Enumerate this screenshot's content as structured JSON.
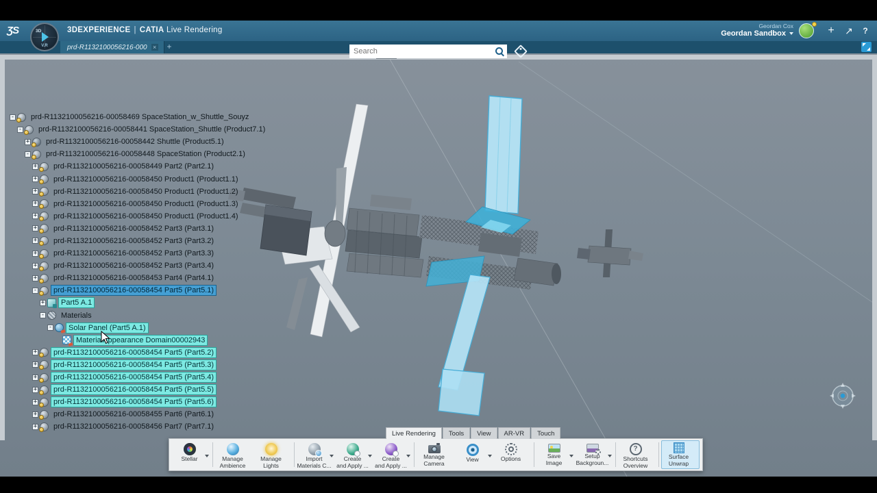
{
  "colors": {
    "accent_blue": "#2a9bd5",
    "selection_blue": "#459fd3",
    "highlight_cyan": "#7de9e2",
    "header_blue": "#2c6384",
    "viewport_gray": "#7c8994"
  },
  "header": {
    "logo": "ƷS",
    "brand": "3DEXPERIENCE",
    "divider": "|",
    "app": "CATIA",
    "mode": "Live Rendering",
    "search": {
      "placeholder": "Search"
    },
    "user": {
      "name": "Geordan Cox",
      "workspace": "Geordan Sandbox"
    },
    "icons": {
      "plus": "+",
      "share": "↗",
      "help": "?"
    }
  },
  "compass": {
    "top": "3D",
    "bottom": "V.R"
  },
  "tabbar": {
    "active_tab": "prd-R1132100056216-000",
    "close": "×",
    "new_tab": "+"
  },
  "tree": {
    "items": [
      {
        "indent": 0,
        "exp": "-",
        "icon": "assembly",
        "label": "prd-R1132100056216-00058469 SpaceStation_w_Shuttle_Souyz",
        "state": "normal"
      },
      {
        "indent": 1,
        "exp": "-",
        "icon": "assembly",
        "label": "prd-R1132100056216-00058441 SpaceStation_Shuttle (Product7.1)",
        "state": "normal"
      },
      {
        "indent": 2,
        "exp": "+",
        "icon": "shuttle",
        "label": "prd-R1132100056216-00058442 Shuttle (Product5.1)",
        "state": "normal"
      },
      {
        "indent": 2,
        "exp": "-",
        "icon": "assembly",
        "label": "prd-R1132100056216-00058448 SpaceStation (Product2.1)",
        "state": "normal"
      },
      {
        "indent": 3,
        "exp": "+",
        "icon": "part",
        "label": "prd-R1132100056216-00058449 Part2 (Part2.1)",
        "state": "normal"
      },
      {
        "indent": 3,
        "exp": "+",
        "icon": "part",
        "label": "prd-R1132100056216-00058450 Product1 (Product1.1)",
        "state": "normal"
      },
      {
        "indent": 3,
        "exp": "+",
        "icon": "part",
        "label": "prd-R1132100056216-00058450 Product1 (Product1.2)",
        "state": "normal"
      },
      {
        "indent": 3,
        "exp": "+",
        "icon": "part",
        "label": "prd-R1132100056216-00058450 Product1 (Product1.3)",
        "state": "normal"
      },
      {
        "indent": 3,
        "exp": "+",
        "icon": "part",
        "label": "prd-R1132100056216-00058450 Product1 (Product1.4)",
        "state": "normal"
      },
      {
        "indent": 3,
        "exp": "+",
        "icon": "part",
        "label": "prd-R1132100056216-00058452 Part3 (Part3.1)",
        "state": "normal"
      },
      {
        "indent": 3,
        "exp": "+",
        "icon": "part",
        "label": "prd-R1132100056216-00058452 Part3 (Part3.2)",
        "state": "normal"
      },
      {
        "indent": 3,
        "exp": "+",
        "icon": "part",
        "label": "prd-R1132100056216-00058452 Part3 (Part3.3)",
        "state": "normal"
      },
      {
        "indent": 3,
        "exp": "+",
        "icon": "part",
        "label": "prd-R1132100056216-00058452 Part3 (Part3.4)",
        "state": "normal"
      },
      {
        "indent": 3,
        "exp": "+",
        "icon": "part",
        "label": "prd-R1132100056216-00058453 Part4 (Part4.1)",
        "state": "normal"
      },
      {
        "indent": 3,
        "exp": "-",
        "icon": "part",
        "label": "prd-R1132100056216-00058454 Part5 (Part5.1)",
        "state": "selected"
      },
      {
        "indent": 4,
        "exp": "+",
        "icon": "rep",
        "label": "Part5 A.1",
        "state": "highlight"
      },
      {
        "indent": 4,
        "exp": "-",
        "icon": "materials",
        "label": "Materials",
        "state": "normal"
      },
      {
        "indent": 5,
        "exp": "-",
        "icon": "material",
        "label": "Solar Panel (Part5 A.1)",
        "state": "highlight"
      },
      {
        "indent": 6,
        "exp": null,
        "icon": "domain",
        "label": "MaterialAppearance Domain00002943",
        "state": "highlight"
      },
      {
        "indent": 3,
        "exp": "+",
        "icon": "part",
        "label": "prd-R1132100056216-00058454 Part5 (Part5.2)",
        "state": "highlight"
      },
      {
        "indent": 3,
        "exp": "+",
        "icon": "part",
        "label": "prd-R1132100056216-00058454 Part5 (Part5.3)",
        "state": "highlight"
      },
      {
        "indent": 3,
        "exp": "+",
        "icon": "part",
        "label": "prd-R1132100056216-00058454 Part5 (Part5.4)",
        "state": "highlight"
      },
      {
        "indent": 3,
        "exp": "+",
        "icon": "part",
        "label": "prd-R1132100056216-00058454 Part5 (Part5.5)",
        "state": "highlight"
      },
      {
        "indent": 3,
        "exp": "+",
        "icon": "part",
        "label": "prd-R1132100056216-00058454 Part5 (Part5.6)",
        "state": "highlight"
      },
      {
        "indent": 3,
        "exp": "+",
        "icon": "part",
        "label": "prd-R1132100056216-00058455 Part6 (Part6.1)",
        "state": "normal"
      },
      {
        "indent": 3,
        "exp": "+",
        "icon": "part",
        "label": "prd-R1132100056216-00058456 Part7 (Part7.1)",
        "state": "normal"
      }
    ]
  },
  "ribbon": {
    "tabs": [
      {
        "label": "Live Rendering",
        "active": true
      },
      {
        "label": "Tools",
        "active": false
      },
      {
        "label": "View",
        "active": false
      },
      {
        "label": "AR-VR",
        "active": false
      },
      {
        "label": "Touch",
        "active": false
      }
    ],
    "buttons": [
      {
        "name": "stellar",
        "icon": "stellar",
        "line1": "Stellar",
        "line2": "",
        "caret": true,
        "group_end": true
      },
      {
        "name": "manage-ambience",
        "icon": "ambience",
        "line1": "Manage",
        "line2": "Ambience",
        "caret": false
      },
      {
        "name": "manage-lights",
        "icon": "lights",
        "line1": "Manage",
        "line2": "Lights",
        "caret": false,
        "group_end": true
      },
      {
        "name": "import-materials",
        "icon": "import-materials",
        "line1": "Import",
        "line2": "Materials C...",
        "caret": true
      },
      {
        "name": "create-and-apply-material",
        "icon": "create-material",
        "line1": "Create",
        "line2": "and Apply ...",
        "caret": true
      },
      {
        "name": "create-and-apply-appearance",
        "icon": "create-appearance",
        "line1": "Create",
        "line2": "and Apply ...",
        "caret": true,
        "group_end": true
      },
      {
        "name": "manage-camera",
        "icon": "camera",
        "line1": "Manage",
        "line2": "Camera",
        "caret": false
      },
      {
        "name": "view",
        "icon": "view",
        "line1": "View",
        "line2": "",
        "caret": true
      },
      {
        "name": "options",
        "icon": "options",
        "line1": "Options",
        "line2": "",
        "caret": false,
        "group_end": true
      },
      {
        "name": "save-image",
        "icon": "save-image",
        "line1": "Save",
        "line2": "Image",
        "caret": true
      },
      {
        "name": "setup-background",
        "icon": "background",
        "line1": "Setup",
        "line2": "Backgroun...",
        "caret": true,
        "group_end": true
      },
      {
        "name": "shortcuts-overview",
        "icon": "shortcuts",
        "line1": "Shortcuts",
        "line2": "Overview",
        "caret": false,
        "group_end": true
      },
      {
        "name": "surface-unwrap",
        "icon": "unwrap",
        "line1": "Surface",
        "line2": "Unwrap",
        "caret": false,
        "active": true
      }
    ]
  }
}
